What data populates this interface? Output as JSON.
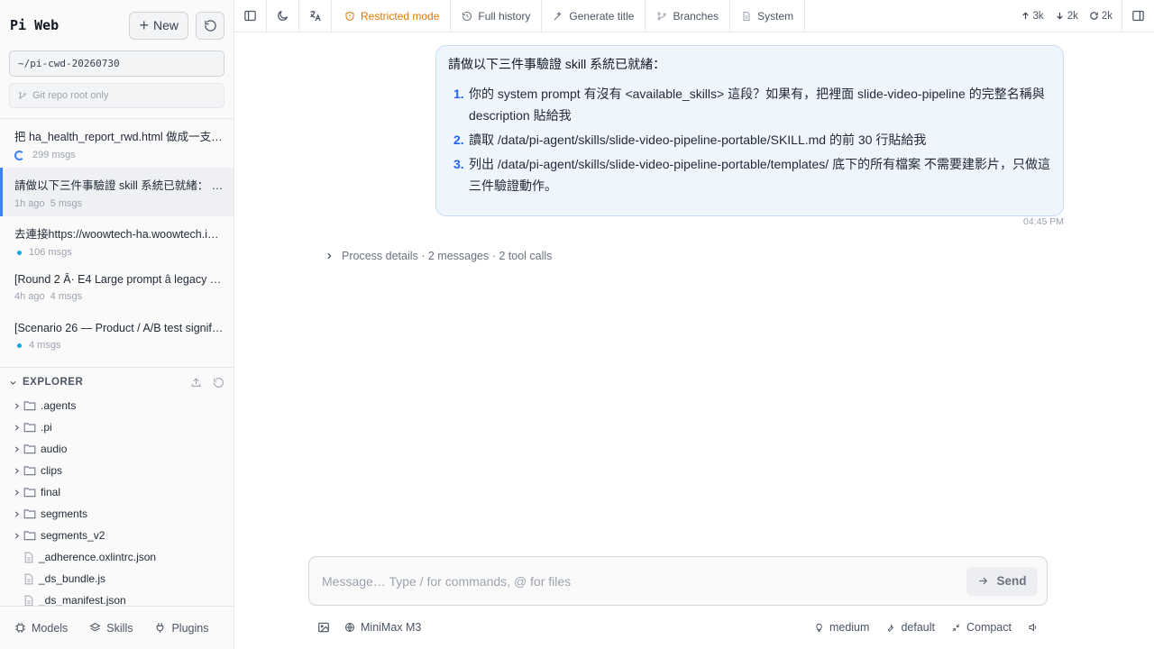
{
  "sidebar": {
    "brand": "Pi Web",
    "new_label": "New",
    "cwd": "~/pi-cwd-20260730",
    "git_placeholder": "Git repo root only",
    "sessions": [
      {
        "title": "把 ha_health_report_rwd.html 做成一支 3…",
        "time": "",
        "msgs": "299 msgs",
        "status": "spinner"
      },
      {
        "title": "請做以下三件事驗證 skill 系統已就緒： 1. …",
        "time": "1h ago",
        "msgs": "5 msgs",
        "status": "none"
      },
      {
        "title": "去連接https://woowtech-ha.woowtech.io/ …",
        "time": "",
        "msgs": "106 msgs",
        "status": "dot"
      },
      {
        "title": "[Round 2 Â· E4 Large prompt â legacy sc…",
        "time": "4h ago",
        "msgs": "4 msgs",
        "status": "none"
      },
      {
        "title": "[Scenario 26 — Product / A/B test signific…",
        "time": "",
        "msgs": "4 msgs",
        "status": "dot"
      }
    ],
    "explorer_title": "EXPLORER",
    "tree": [
      {
        "name": ".agents",
        "type": "folder"
      },
      {
        "name": ".pi",
        "type": "folder"
      },
      {
        "name": "audio",
        "type": "folder"
      },
      {
        "name": "clips",
        "type": "folder"
      },
      {
        "name": "final",
        "type": "folder"
      },
      {
        "name": "segments",
        "type": "folder"
      },
      {
        "name": "segments_v2",
        "type": "folder"
      },
      {
        "name": "_adherence.oxlintrc.json",
        "type": "file"
      },
      {
        "name": "_ds_bundle.js",
        "type": "file"
      },
      {
        "name": "_ds_manifest.json",
        "type": "file"
      }
    ],
    "bottom": {
      "models": "Models",
      "skills": "Skills",
      "plugins": "Plugins"
    }
  },
  "toolbar": {
    "restricted": "Restricted mode",
    "history": "Full history",
    "generate": "Generate title",
    "branches": "Branches",
    "system": "System",
    "up_count": "3k",
    "down_count": "2k",
    "cycle_count": "2k"
  },
  "message": {
    "intro": "請做以下三件事驗證 skill 系統已就緒：",
    "items": [
      {
        "num": "1.",
        "text": "你的 system prompt 有沒有 <available_skills> 這段？如果有，把裡面 slide-video-pipeline 的完整名稱與 description 貼給我"
      },
      {
        "num": "2.",
        "text": "讀取 /data/pi-agent/skills/slide-video-pipeline-portable/SKILL.md 的前 30 行貼給我"
      },
      {
        "num": "3.",
        "text": "列出 /data/pi-agent/skills/slide-video-pipeline-portable/templates/ 底下的所有檔案 不需要建影片，只做這三件驗證動作。"
      }
    ],
    "time": "04:45 PM"
  },
  "process": "Process details · 2 messages · 2 tool calls",
  "composer": {
    "placeholder": "Message… Type / for commands, @ for files",
    "send": "Send"
  },
  "footer": {
    "model": "MiniMax M3",
    "effort": "medium",
    "mode": "default",
    "compact": "Compact"
  }
}
